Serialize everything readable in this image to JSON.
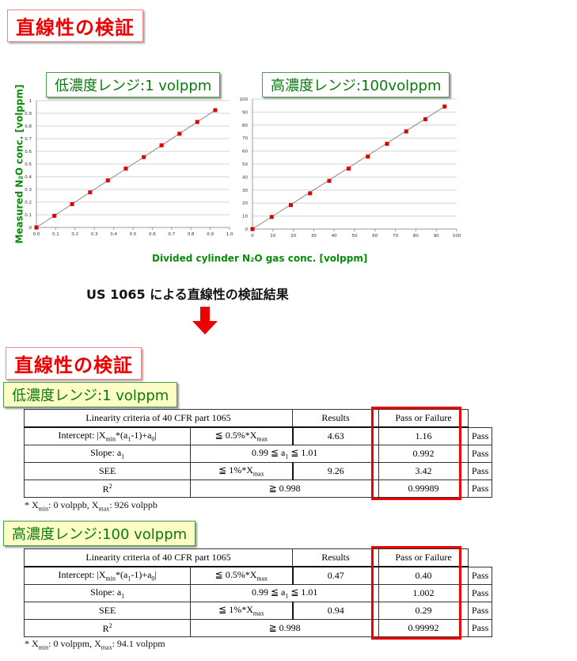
{
  "top_title": "直線性の検証",
  "x_axis_title": "Divided cylinder N₂O gas conc. [volppm]",
  "y_axis_title": "Measured N₂O conc. [volppm]",
  "caption": "US 1065 による直線性の検証結果",
  "arrow_icon": "down-arrow",
  "arrow_color": "#ee0000",
  "chart_data": [
    {
      "type": "scatter",
      "title": "低濃度レンジ:1 volppm",
      "xlabel": "Divided cylinder N2O gas conc. [volppm]",
      "ylabel": "Measured N2O conc. [volppm]",
      "xlim": [
        0,
        1.0
      ],
      "ylim": [
        0,
        1
      ],
      "xticks": [
        "0.0",
        "0.1",
        "0.2",
        "0.3",
        "0.4",
        "0.5",
        "0.6",
        "0.7",
        "0.8",
        "0.9",
        "1.0"
      ],
      "yticks": [
        "0",
        "0.1",
        "0.2",
        "0.3",
        "0.4",
        "0.5",
        "0.6",
        "0.7",
        "0.8",
        "0.9",
        "1"
      ],
      "grid": true,
      "marker_color": "#e00000",
      "fit_line": true,
      "x": [
        0.0,
        0.093,
        0.185,
        0.278,
        0.37,
        0.463,
        0.556,
        0.648,
        0.741,
        0.833,
        0.926
      ],
      "y": [
        0.0,
        0.092,
        0.184,
        0.277,
        0.371,
        0.464,
        0.555,
        0.648,
        0.739,
        0.832,
        0.925
      ]
    },
    {
      "type": "scatter",
      "title": "高濃度レンジ:100volppm",
      "xlabel": "Divided cylinder N2O gas conc. [volppm]",
      "ylabel": "Measured N2O conc. [volppm]",
      "xlim": [
        0,
        100
      ],
      "ylim": [
        0,
        100
      ],
      "xticks": [
        "0",
        "10",
        "20",
        "30",
        "40",
        "50",
        "60",
        "70",
        "80",
        "90",
        "100"
      ],
      "yticks": [
        "0",
        "10",
        "20",
        "30",
        "40",
        "50",
        "60",
        "70",
        "80",
        "90",
        "100"
      ],
      "grid": true,
      "marker_color": "#e00000",
      "fit_line": true,
      "x": [
        0,
        9.4,
        18.8,
        28.2,
        37.6,
        47.1,
        56.5,
        65.9,
        75.3,
        84.7,
        94.1
      ],
      "y": [
        0,
        9.3,
        18.5,
        27.5,
        37.1,
        46.5,
        55.8,
        65.6,
        75.1,
        84.5,
        94.3
      ]
    }
  ],
  "results_section": {
    "title": "直線性の検証",
    "tables": [
      {
        "range_label": "低濃度レンジ:1 volppm",
        "header": {
          "criteria": "Linearity criteria of 40 CFR part 1065",
          "results": "Results",
          "pass": "Pass or Failure"
        },
        "rows": [
          {
            "name": "Intercept: |Xmin*(a1-1)+a0|",
            "criterion": "≦ 0.5%*Xmax",
            "limit": "4.63",
            "result": "1.16",
            "pass": "Pass"
          },
          {
            "name": "Slope: a1",
            "criterion": "0.99 ≦ a1 ≦ 1.01",
            "limit": null,
            "result": "0.992",
            "pass": "Pass"
          },
          {
            "name": "SEE",
            "criterion": "≦ 1%*Xmax",
            "limit": "9.26",
            "result": "3.42",
            "pass": "Pass"
          },
          {
            "name": "R²",
            "criterion": "≧ 0.998",
            "limit": null,
            "result": "0.99989",
            "pass": "Pass"
          }
        ],
        "note": "*  Xmin: 0 volppb, Xmax: 926 volppb"
      },
      {
        "range_label": "高濃度レンジ:100 volppm",
        "header": {
          "criteria": "Linearity criteria of 40 CFR part 1065",
          "results": "Results",
          "pass": "Pass or Failure"
        },
        "rows": [
          {
            "name": "Intercept: |Xmin*(a1-1)+a0|",
            "criterion": "≦ 0.5%*Xmax",
            "limit": "0.47",
            "result": "0.40",
            "pass": "Pass"
          },
          {
            "name": "Slope: a1",
            "criterion": "0.99 ≦ a1 ≦ 1.01",
            "limit": null,
            "result": "1.002",
            "pass": "Pass"
          },
          {
            "name": "SEE",
            "criterion": "≦ 1%*Xmax",
            "limit": "0.94",
            "result": "0.29",
            "pass": "Pass"
          },
          {
            "name": "R²",
            "criterion": "≧ 0.998",
            "limit": null,
            "result": "0.99992",
            "pass": "Pass"
          }
        ],
        "note": "*  Xmin: 0 volppm, Xmax: 94.1 volppm"
      }
    ]
  }
}
